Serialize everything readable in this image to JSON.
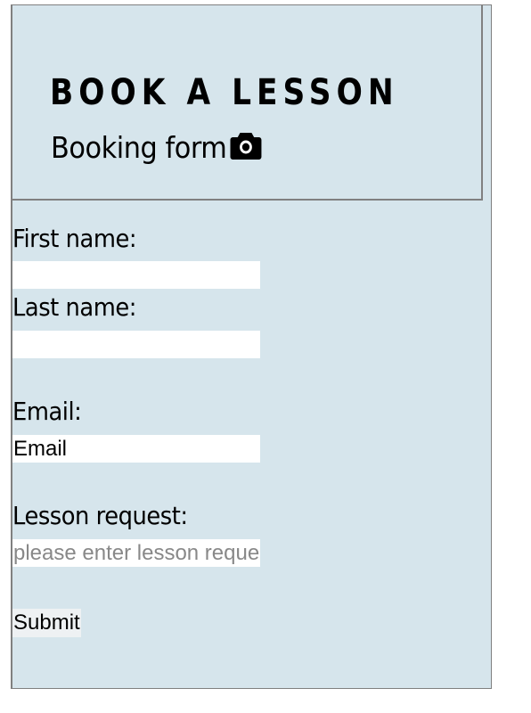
{
  "header": {
    "title": "BOOK A LESSON",
    "subtitle": "Booking form",
    "subtitle_icon": "camera-icon"
  },
  "form": {
    "first_name": {
      "label": "First name:",
      "value": "",
      "placeholder": ""
    },
    "last_name": {
      "label": "Last name:",
      "value": "",
      "placeholder": ""
    },
    "email": {
      "label": "Email:",
      "value": "",
      "placeholder": "Email"
    },
    "lesson_request": {
      "label": "Lesson request:",
      "value": "",
      "placeholder": "please enter lesson requests"
    },
    "submit_label": "Submit"
  },
  "colors": {
    "page_background": "#d6e5ec",
    "border": "#808080",
    "input_background": "#ffffff"
  }
}
